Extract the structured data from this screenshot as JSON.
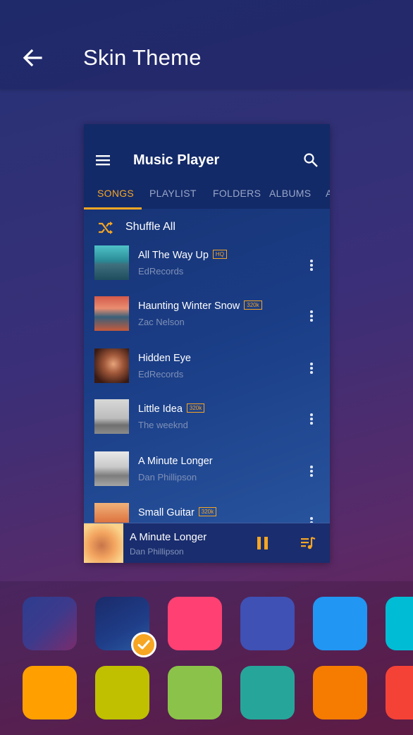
{
  "header": {
    "title": "Skin Theme"
  },
  "preview": {
    "app_title": "Music Player",
    "tabs": [
      "SONGS",
      "PLAYLIST",
      "FOLDERS",
      "ALBUMS",
      "A"
    ],
    "shuffle_label": "Shuffle All",
    "songs": [
      {
        "title": "All The Way Up",
        "badge": "HQ",
        "artist": "EdRecords"
      },
      {
        "title": "Haunting Winter Snow",
        "badge": "320k",
        "artist": "Zac Nelson"
      },
      {
        "title": "Hidden Eye",
        "badge": "",
        "artist": "EdRecords"
      },
      {
        "title": "Little Idea",
        "badge": "320k",
        "artist": "The weeknd"
      },
      {
        "title": "A Minute Longer",
        "badge": "",
        "artist": "Dan Phillipson"
      },
      {
        "title": "Small Guitar",
        "badge": "320k",
        "artist": ""
      }
    ],
    "now_playing": {
      "title": "A Minute Longer",
      "artist": "Dan Phillipson"
    }
  },
  "colors": {
    "accent": "#f6a623"
  },
  "themes": {
    "selected_index": 1,
    "swatches": [
      "gradient-blue-magenta",
      "gradient-navy",
      "#ff4073",
      "#3f51b5",
      "#2196f3",
      "#00bcd4",
      "#ffa000",
      "#c0c000",
      "#8bc34a",
      "#26a69a",
      "#f57c00",
      "#f44336"
    ]
  }
}
